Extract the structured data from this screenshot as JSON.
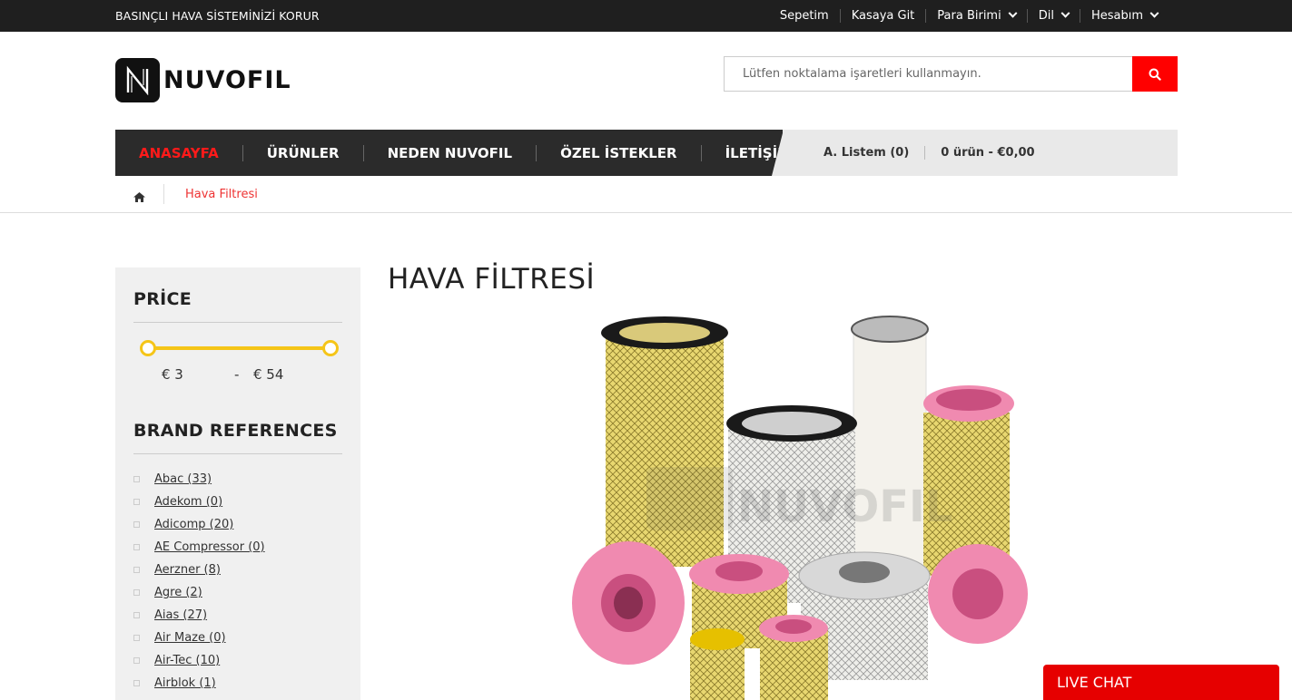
{
  "topbar": {
    "tagline": "BASINÇLI HAVA SİSTEMİNİZİ KORUR",
    "links": [
      {
        "label": "Sepetim",
        "dropdown": false
      },
      {
        "label": "Kasaya Git",
        "dropdown": false
      },
      {
        "label": "Para Birimi",
        "dropdown": true
      },
      {
        "label": "Dil",
        "dropdown": true
      },
      {
        "label": "Hesabım",
        "dropdown": true
      }
    ]
  },
  "header": {
    "logo_text": "NUVOFIL",
    "search_placeholder": "Lütfen noktalama işaretleri kullanmayın.",
    "search_icon": "search-icon"
  },
  "nav": {
    "items": [
      "ANASAYFA",
      "ÜRÜNLER",
      "NEDEN NUVOFIL",
      "ÖZEL İSTEKLER",
      "İLETİŞİM"
    ],
    "wishlist": "A. Listem (0)",
    "cart": "0 ürün - €0,00"
  },
  "breadcrumb": {
    "home_icon": "home-icon",
    "current": "Hava Filtresi"
  },
  "sidebar": {
    "price_title": "PRİCE",
    "price_min": "€ 3",
    "price_sep": "-",
    "price_max": "€ 54",
    "brand_title": "BRAND REFERENCES",
    "brands": [
      "Abac (33)",
      "Adekom (0)",
      "Adicomp (20)",
      "AE Compressor (0)",
      "Aerzner (8)",
      "Agre (2)",
      "Aias (27)",
      "Air Maze (0)",
      "Air-Tec (10)",
      "Airblok (1)"
    ]
  },
  "main": {
    "title": "HAVA FİLTRESİ",
    "watermark": "NUVOFIL"
  },
  "live_chat": "LIVE CHAT",
  "colors": {
    "accent_red": "#ff0000",
    "slider_yellow": "#f5c518",
    "nav_dark": "#2b2b2b",
    "topbar_dark": "#1f1f1f"
  }
}
